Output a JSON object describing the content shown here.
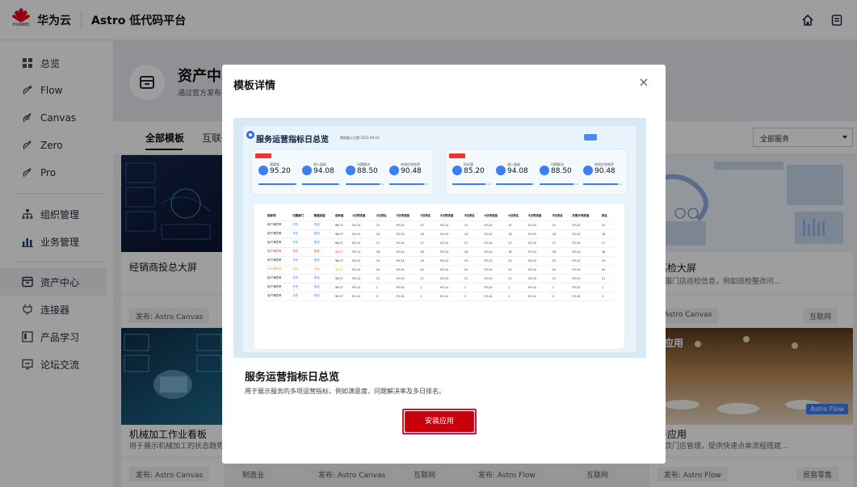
{
  "topbar": {
    "brand": "华为云",
    "logo_sub": "HUAWEI",
    "product": "Astro 低代码平台",
    "icons": [
      "home-icon",
      "document-icon"
    ]
  },
  "sidebar": {
    "items": [
      {
        "label": "总览",
        "icon": "grid-icon"
      },
      {
        "label": "Flow",
        "icon": "flow-icon"
      },
      {
        "label": "Canvas",
        "icon": "canvas-icon"
      },
      {
        "label": "Zero",
        "icon": "zero-icon"
      },
      {
        "label": "Pro",
        "icon": "pro-icon"
      },
      {
        "label": "组织管理",
        "icon": "org-tree-icon"
      },
      {
        "label": "业务管理",
        "icon": "bar-chart-icon"
      },
      {
        "label": "资产中心",
        "icon": "asset-box-icon",
        "active": true
      },
      {
        "label": "连接器",
        "icon": "connector-icon"
      },
      {
        "label": "产品学习",
        "icon": "book-icon"
      },
      {
        "label": "论坛交流",
        "icon": "chat-icon"
      }
    ]
  },
  "hero": {
    "title": "资产中心",
    "subtitle": "通过官方发布"
  },
  "tabs": [
    {
      "label": "全部模板",
      "active": true
    },
    {
      "label": "互联"
    }
  ],
  "filter": {
    "selected": "全部服务"
  },
  "cards": [
    {
      "title": "经销商投总大屏",
      "desc": "",
      "publish": "发布: Astro Canvas",
      "category": ""
    },
    {
      "title": "巡检大屏",
      "desc": "全国门店巡检信息，例如巡检整改问...",
      "publish": "Astro Canvas",
      "category": "互联网"
    },
    {
      "title": "机械加工作业看板",
      "desc": "用于展示机械加工的状态趋势...",
      "publish": "发布: Astro Canvas",
      "category": "制造业"
    },
    {
      "title": "",
      "desc": "",
      "publish": "发布: Astro Canvas",
      "category": "互联网"
    },
    {
      "title": "",
      "desc": "",
      "publish": "发布: Astro Flow",
      "category": "互联网"
    },
    {
      "title": "餐应用",
      "desc": "餐饮门店管理，提供快速点单流程搭建...",
      "publish": "发布: Astro Flow",
      "category": "贸易零售"
    }
  ],
  "card_overlay_labels": {
    "dining_banner": "餐应用",
    "flow_badge": "Astro Flow"
  },
  "modal": {
    "title": "模板详情",
    "close_symbol": "×",
    "preview": {
      "title": "服务运营指标日总览",
      "date": "数据截止日期 2021-08-10",
      "kpis": [
        {
          "label": "满意度",
          "value": "95.20",
          "pct": 0.95
        },
        {
          "label": "调入量级",
          "value": "94.08",
          "pct": 0.94
        },
        {
          "label": "问题解决",
          "value": "88.50",
          "pct": 0.88
        },
        {
          "label": "热线应答效率",
          "value": "90.48",
          "pct": 0.9
        },
        {
          "label": "投诉量",
          "value": "85.20",
          "pct": 0.85
        },
        {
          "label": "调入量级",
          "value": "94.08",
          "pct": 0.94
        },
        {
          "label": "问题解决",
          "value": "88.50",
          "pct": 0.88
        },
        {
          "label": "热线应答效率",
          "value": "90.48",
          "pct": 0.9
        }
      ],
      "table_headers": [
        "指标项",
        "归属部门",
        "数据类型",
        "目标值",
        "1日完成值",
        "1日排名",
        "2日完成值",
        "2日排名",
        "3日完成值",
        "3日排名",
        "4日完成值",
        "4日排名",
        "5日完成值",
        "5日排名",
        "月累计完成值",
        "排名"
      ],
      "table_rows": [
        [
          "用户满意率",
          "华东",
          "热线",
          "98.07",
          "93.24",
          "15",
          "93.24",
          "15",
          "93.24",
          "15",
          "93.24",
          "15",
          "93.24",
          "15",
          "93.24",
          "15"
        ],
        [
          "用户满意率",
          "华东",
          "热线",
          "98.07",
          "93.24",
          "16",
          "93.24",
          "16",
          "93.24",
          "16",
          "93.24",
          "16",
          "93.24",
          "16",
          "93.24",
          "16"
        ],
        [
          "用户满意率",
          "华东",
          "热线",
          "98.07",
          "93.24",
          "17",
          "93.24",
          "17",
          "93.24",
          "17",
          "93.24",
          "17",
          "93.24",
          "17",
          "93.24",
          "17"
        ],
        [
          "用户满意率",
          "华东",
          "热线",
          "98.07",
          "93.24",
          "18",
          "93.24",
          "18",
          "93.24",
          "18",
          "93.24",
          "18",
          "93.24",
          "18",
          "93.24",
          "18"
        ],
        [
          "用户满意率",
          "华东",
          "热线",
          "98.07",
          "93.24",
          "19",
          "93.24",
          "19",
          "93.24",
          "19",
          "93.24",
          "19",
          "93.24",
          "19",
          "93.24",
          "19"
        ],
        [
          "用户满意率",
          "华东",
          "热线",
          "98.07",
          "93.24",
          "20",
          "93.24",
          "20",
          "93.24",
          "20",
          "93.24",
          "20",
          "93.24",
          "20",
          "93.24",
          "20"
        ],
        [
          "用户满意率",
          "华东",
          "热线",
          "98.07",
          "93.24",
          "21",
          "93.24",
          "21",
          "93.24",
          "21",
          "93.24",
          "21",
          "93.24",
          "21",
          "93.24",
          "21"
        ],
        [
          "用户满意率",
          "华东",
          "热线",
          "98.07",
          "93.24",
          "1",
          "93.24",
          "1",
          "93.24",
          "1",
          "93.24",
          "1",
          "93.24",
          "1",
          "93.24",
          "1"
        ],
        [
          "用户满意率",
          "华东",
          "热线",
          "98.07",
          "93.24",
          "2",
          "93.24",
          "2",
          "93.24",
          "2",
          "93.24",
          "2",
          "93.24",
          "2",
          "93.24",
          "2"
        ]
      ]
    },
    "template_title": "服务运营指标日总览",
    "template_desc": "用于展示服务的多项运营指标，例如满意度、问题解决率及多日排名。",
    "install_label": "安装应用"
  },
  "colors": {
    "accent": "#c7000b",
    "brand_red": "#e60012",
    "blue": "#3b7ff2",
    "overlay": "rgba(0,0,0,0.38)"
  }
}
